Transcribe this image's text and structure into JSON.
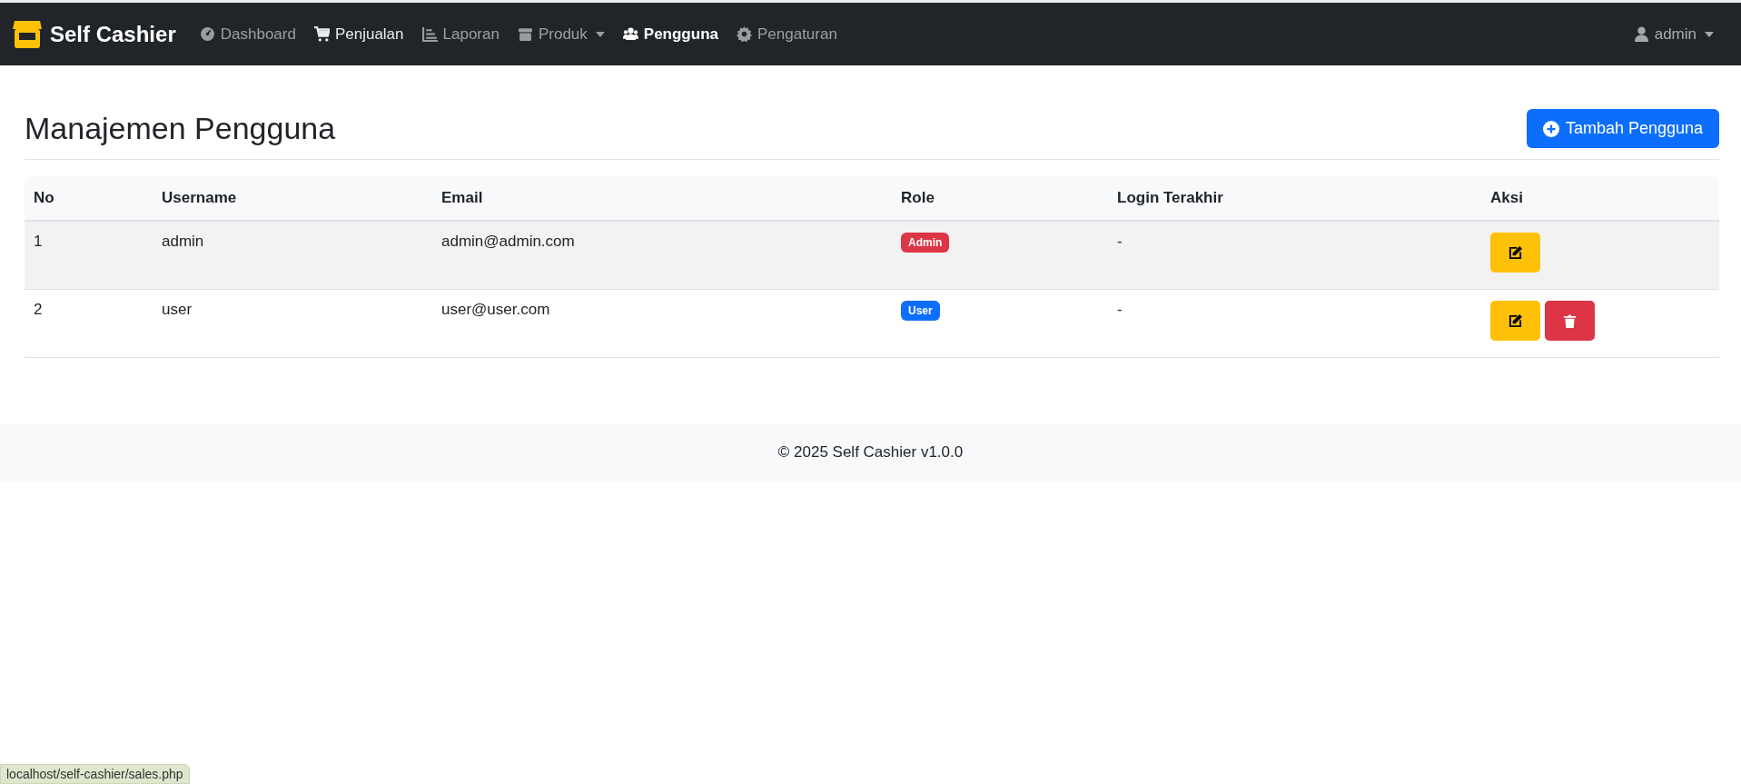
{
  "navbar": {
    "brand": "Self Cashier",
    "items": [
      {
        "label": "Dashboard",
        "selected": false,
        "hovered": false,
        "dropdown": false
      },
      {
        "label": "Penjualan",
        "selected": false,
        "hovered": true,
        "dropdown": false
      },
      {
        "label": "Laporan",
        "selected": false,
        "hovered": false,
        "dropdown": false
      },
      {
        "label": "Produk",
        "selected": false,
        "hovered": false,
        "dropdown": true
      },
      {
        "label": "Pengguna",
        "selected": true,
        "hovered": false,
        "dropdown": false
      },
      {
        "label": "Pengaturan",
        "selected": false,
        "hovered": false,
        "dropdown": false
      }
    ],
    "user_menu": "admin"
  },
  "page": {
    "title": "Manajemen Pengguna",
    "add_button": "Tambah Pengguna"
  },
  "table": {
    "columns": [
      "No",
      "Username",
      "Email",
      "Role",
      "Login Terakhir",
      "Aksi"
    ],
    "rows": [
      {
        "no": "1",
        "username": "admin",
        "email": "admin@admin.com",
        "role": {
          "label": "Admin",
          "color": "#dc3545"
        },
        "last_login": "-",
        "actions": [
          {
            "kind": "edit"
          }
        ]
      },
      {
        "no": "2",
        "username": "user",
        "email": "user@user.com",
        "role": {
          "label": "User",
          "color": "#0d6efd"
        },
        "last_login": "-",
        "actions": [
          {
            "kind": "edit"
          },
          {
            "kind": "delete"
          }
        ]
      }
    ]
  },
  "footer": "© 2025 Self Cashier v1.0.0",
  "status_bar": "localhost/self-cashier/sales.php"
}
